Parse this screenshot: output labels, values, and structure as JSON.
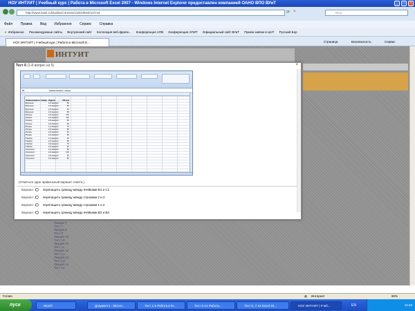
{
  "window": {
    "title": "НОУ ИНТУИТ | Учебный курс | Работа в Microsoft Excel 2007 - Windows Internet Explorer предоставлен компанией ОАНО ВПО ВУиТ"
  },
  "address": {
    "url": "http://www.intuit.ru/studies/courses/118/23/test/1/2744",
    "search_placeholder": "Bing"
  },
  "menu": [
    "Файл",
    "Правка",
    "Вид",
    "Избранное",
    "Сервис",
    "Справка"
  ],
  "favorites": {
    "label": "Избранное",
    "items": [
      "Рекомендуемые сайты",
      "Внутренний сайт",
      "Коллекция веб-фрагм...",
      "Конференция АПВ",
      "Конференция АПИТ",
      "Официальный сайт ВУиТ",
      "Прием заявок в ЦНТ",
      "Русский Бор"
    ]
  },
  "tab": {
    "label": "НОУ ИНТУИТ | Учебный курс | Работа в Microsoft E..."
  },
  "commands": [
    "Страница",
    "Безопасность",
    "Сервис"
  ],
  "logo": "ИНТУИТ",
  "modal": {
    "title": "Тест 6",
    "subtitle": "(1-й вопрос из 5)",
    "instruction": "(Отметьте один правильный вариант ответа.)",
    "options": [
      {
        "label": "Вариант 1",
        "text": "перетащить границу между ячейками  B1  и  C1"
      },
      {
        "label": "Вариант 2",
        "text": "перетащить границу между строками  2  и  3"
      },
      {
        "label": "Вариант 3",
        "text": "перетащить границу между строками  1  и  2"
      },
      {
        "label": "Вариант 4",
        "text": "перетащить границу между ячейками  B2  и  B3"
      }
    ]
  },
  "spreadsheet": {
    "formula_cell": "B1",
    "formula_text": "Наименование товара",
    "columns": [
      "A",
      "B",
      "C",
      "D",
      "E",
      "F",
      "G",
      "H",
      "I",
      "J",
      "K"
    ],
    "header": [
      "Наименование товара",
      "Неделя",
      "Объем"
    ],
    "rows": [
      [
        "Воронеж",
        "1-й квартал",
        "80"
      ],
      [
        "Воронеж",
        "2-й квартал",
        "80"
      ],
      [
        "Воронеж",
        "3-й квартал",
        "90"
      ],
      [
        "Воронеж",
        "4-й квартал",
        "80"
      ],
      [
        "Липецк",
        "1-й квартал",
        "100"
      ],
      [
        "Липецк",
        "2-й квартал",
        "110"
      ],
      [
        "Липецк",
        "3-й квартал",
        "80"
      ],
      [
        "Липецк",
        "4-й квартал",
        "90"
      ],
      [
        "Рязань",
        "1-й квартал",
        "70"
      ],
      [
        "Рязань",
        "2-й квартал",
        "80"
      ],
      [
        "Рязань",
        "3-й квартал",
        "60"
      ],
      [
        "Рязань",
        "4-й квартал",
        "80"
      ],
      [
        "Тамбов",
        "1-й квартал",
        "90"
      ],
      [
        "Тамбов",
        "2-й квартал",
        "80"
      ],
      [
        "Тамбов",
        "3-й квартал",
        "70"
      ],
      [
        "Тамбов",
        "4-й квартал",
        "90"
      ],
      [
        "Смоленск",
        "1-й квартал",
        "80"
      ],
      [
        "Смоленск",
        "2-й квартал",
        "100"
      ],
      [
        "Смоленск",
        "3-й квартал",
        "90"
      ],
      [
        "Смоленск",
        "4-й квартал",
        "80"
      ]
    ]
  },
  "side_links": [
    "Лекция 7",
    "Тест 7",
    "Лекция 8",
    "Тест 8",
    "Лекция 10",
    "Тест 10",
    "Лекция 11",
    "Тест 11",
    "Лекция 12",
    "Тест 12",
    "Лекция 13",
    "Тест 13",
    "Лекция 14",
    "Тест 14"
  ],
  "status": {
    "left": "Готово",
    "zone": "Интернет",
    "zoom": "80%"
  },
  "taskbar": {
    "start": "пуск",
    "tasks": [
      "Word7",
      "Документ1 - Micros...",
      "Тест 1-5 Работа в M...",
      "Тест 6-14 Работа...",
      "Тест 5, 7-14 Excel 20...",
      "НОУ ИНТУИТ | Учеб..."
    ],
    "lang": "EN",
    "clock": "12:48"
  }
}
